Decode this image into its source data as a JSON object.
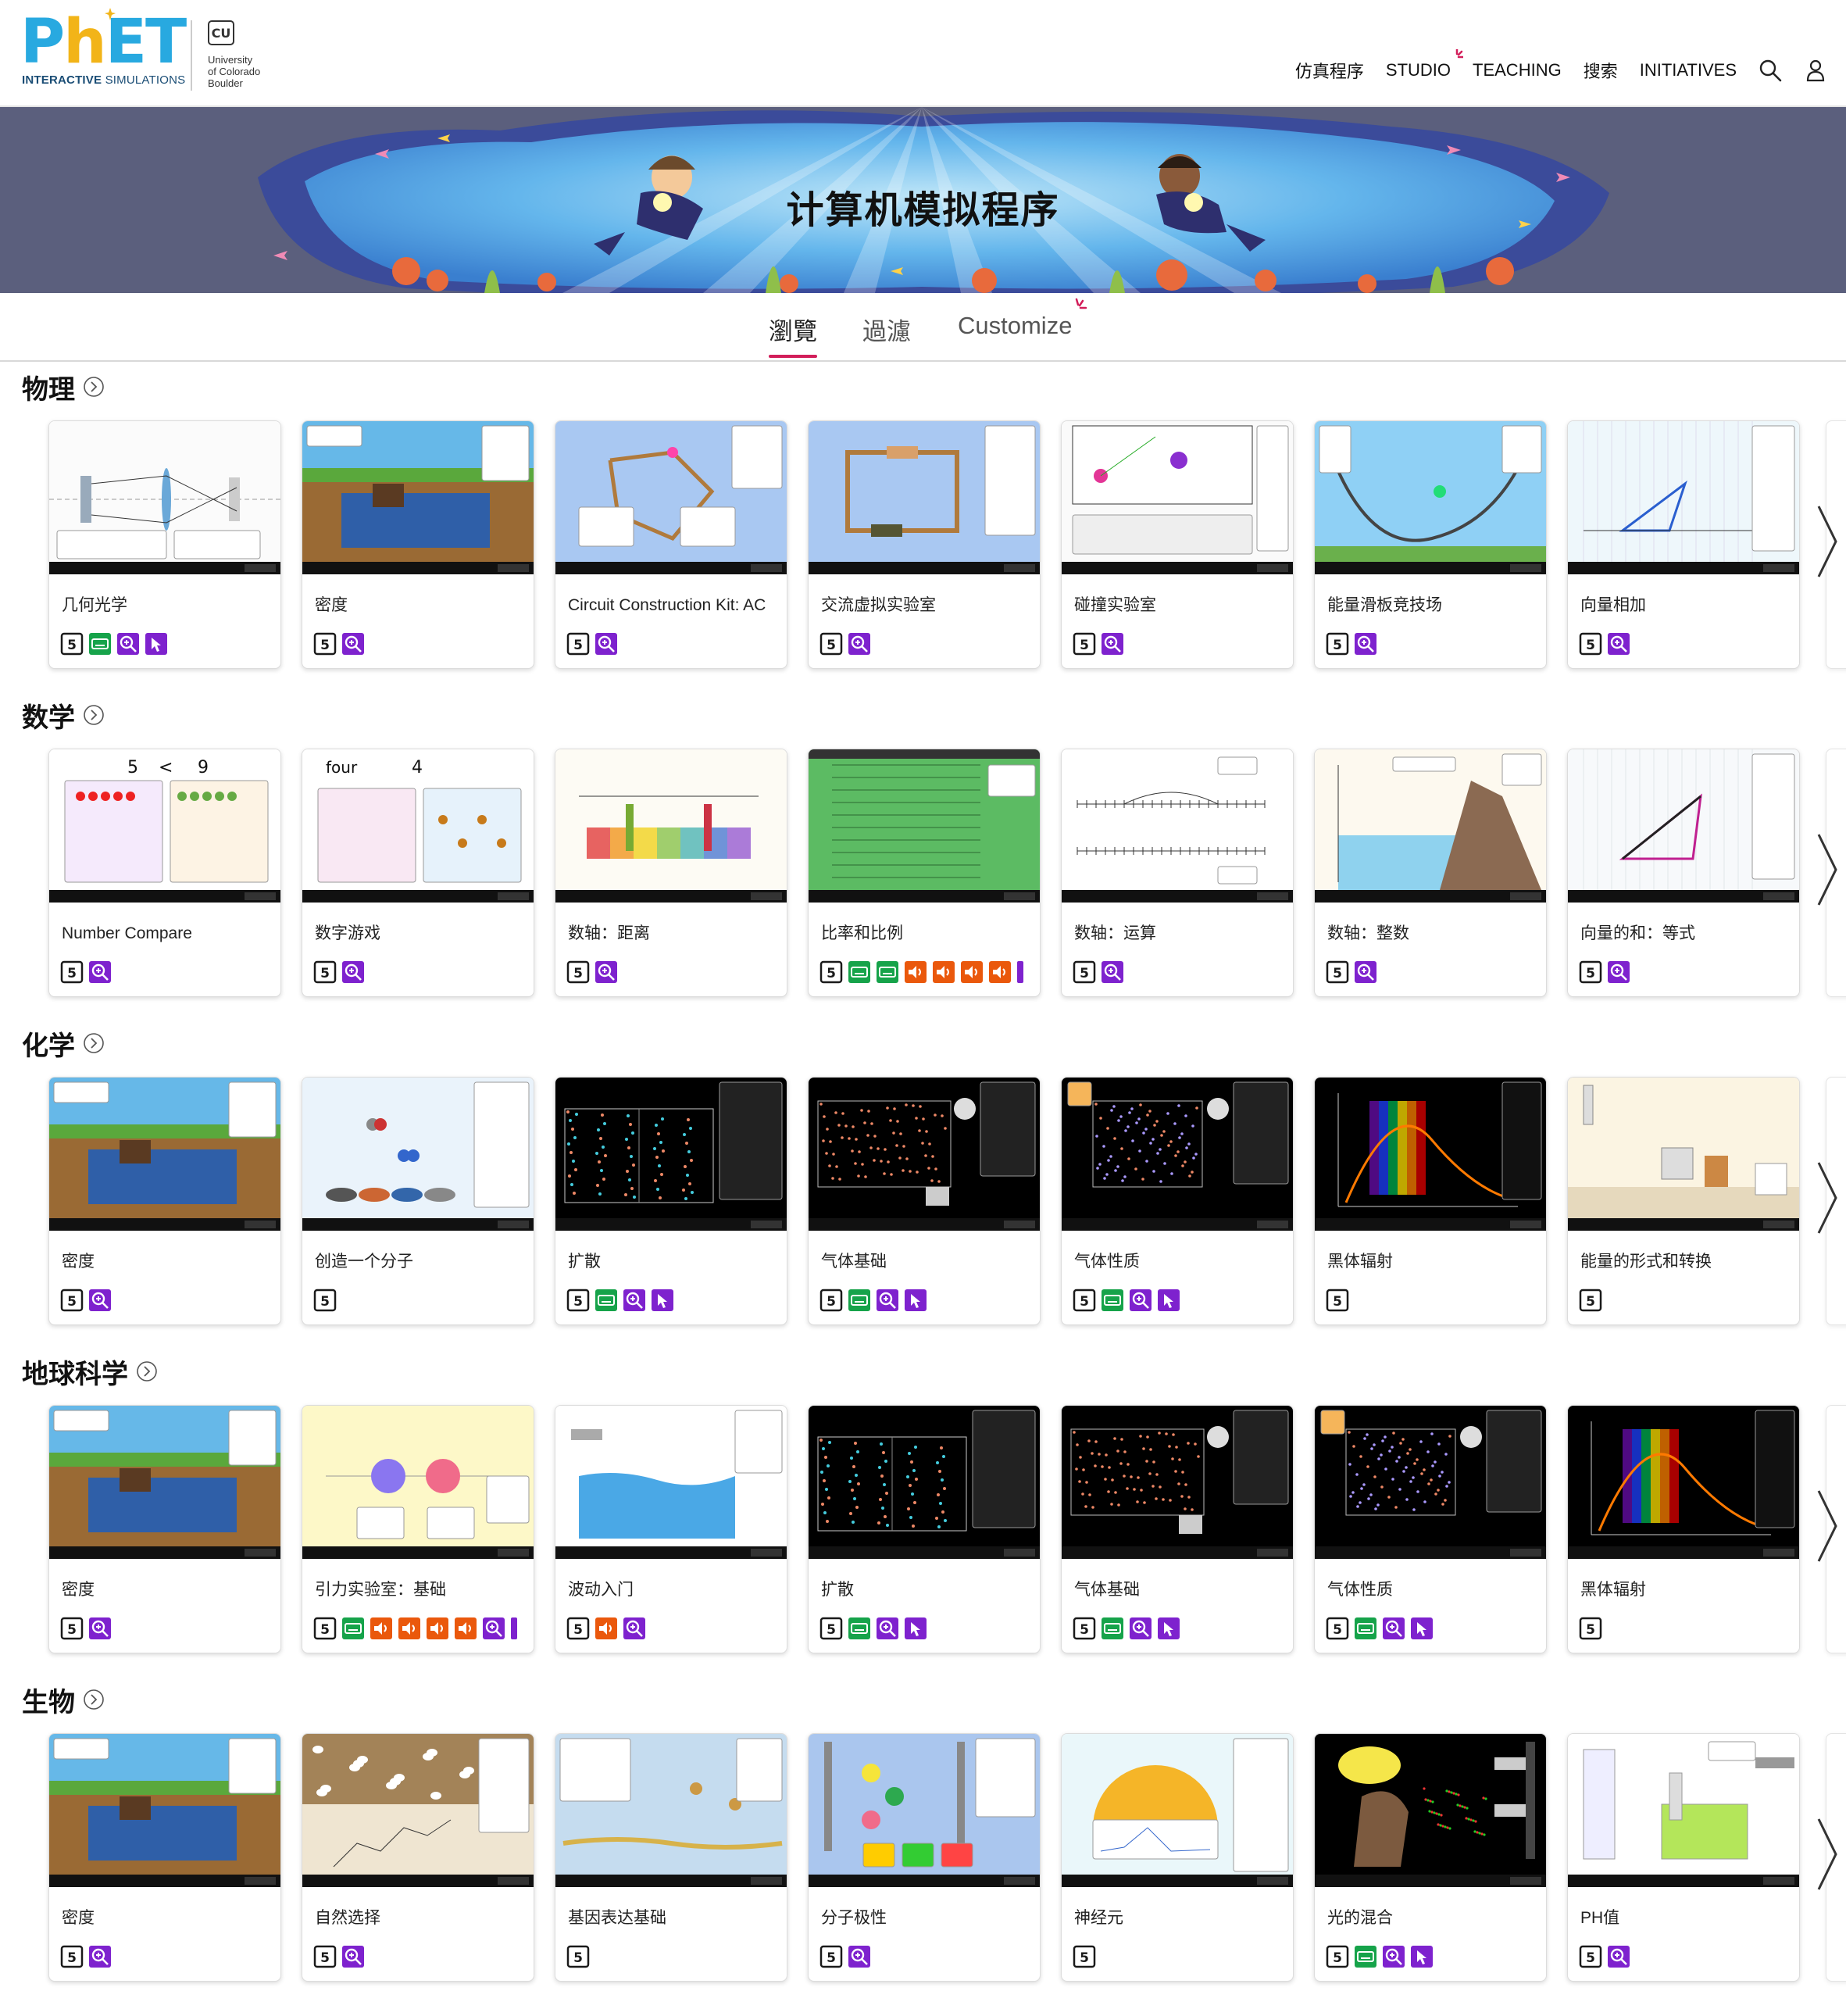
{
  "brand": {
    "logo_text": "PhET",
    "logo_subtitle_bold": "INTERACTIVE",
    "logo_subtitle_rest": " SIMULATIONS",
    "university": [
      "University",
      "of Colorado",
      "Boulder"
    ]
  },
  "nav": {
    "items": [
      "仿真程序",
      "STUDIO",
      "TEACHING",
      "搜索",
      "INITIATIVES"
    ],
    "icons": [
      "search-icon",
      "user-icon"
    ]
  },
  "banner": {
    "title": "计算机模拟程序"
  },
  "tabs": {
    "browse": "瀏覽",
    "filter": "過濾",
    "customize": "Customize"
  },
  "colors": {
    "accent": "#d21e5a",
    "logo_blue": "#28a9e0",
    "logo_yellow": "#f2b418",
    "badge_html5": "#1a1a1a",
    "badge_keyboard": "#16a34a",
    "badge_inclusive": "#7e22ce",
    "badge_sound": "#ea580c"
  },
  "sections": [
    {
      "title": "物理",
      "cards": [
        {
          "title": "几何光学",
          "theme": "optics",
          "badges": [
            "html5",
            "keyboard",
            "zoom",
            "interactive"
          ]
        },
        {
          "title": "密度",
          "theme": "density",
          "badges": [
            "html5",
            "zoom"
          ]
        },
        {
          "title": "Circuit Construction Kit: AC",
          "theme": "circuit",
          "badges": [
            "html5",
            "zoom"
          ]
        },
        {
          "title": "交流虚拟实验室",
          "theme": "circuitlab",
          "badges": [
            "html5",
            "zoom"
          ]
        },
        {
          "title": "碰撞实验室",
          "theme": "collision",
          "badges": [
            "html5",
            "zoom"
          ]
        },
        {
          "title": "能量滑板竞技场",
          "theme": "skate",
          "badges": [
            "html5",
            "zoom"
          ]
        },
        {
          "title": "向量相加",
          "theme": "vector",
          "badges": [
            "html5",
            "zoom"
          ]
        }
      ]
    },
    {
      "title": "数学",
      "cards": [
        {
          "title": "Number Compare",
          "theme": "numcompare",
          "badges": [
            "html5",
            "zoom"
          ]
        },
        {
          "title": "数字游戏",
          "theme": "numplay",
          "badges": [
            "html5",
            "zoom"
          ]
        },
        {
          "title": "数轴：距离",
          "theme": "numline",
          "badges": [
            "html5",
            "zoom"
          ]
        },
        {
          "title": "比率和比例",
          "theme": "ratio",
          "badges": [
            "html5",
            "keyboard",
            "keyboard",
            "sound",
            "sound",
            "sound",
            "sound",
            "more"
          ]
        },
        {
          "title": "数轴：运算",
          "theme": "numops",
          "badges": [
            "html5",
            "zoom"
          ]
        },
        {
          "title": "数轴：整数",
          "theme": "integers",
          "badges": [
            "html5",
            "zoom"
          ]
        },
        {
          "title": "向量的和：等式",
          "theme": "vector2",
          "badges": [
            "html5",
            "zoom"
          ]
        }
      ]
    },
    {
      "title": "化学",
      "cards": [
        {
          "title": "密度",
          "theme": "density",
          "badges": [
            "html5",
            "zoom"
          ]
        },
        {
          "title": "创造一个分子",
          "theme": "molecule",
          "badges": [
            "html5"
          ]
        },
        {
          "title": "扩散",
          "theme": "diffusion",
          "badges": [
            "html5",
            "keyboard",
            "zoom",
            "interactive"
          ]
        },
        {
          "title": "气体基础",
          "theme": "gas",
          "badges": [
            "html5",
            "keyboard",
            "zoom",
            "interactive"
          ]
        },
        {
          "title": "气体性质",
          "theme": "gas2",
          "badges": [
            "html5",
            "keyboard",
            "zoom",
            "interactive"
          ]
        },
        {
          "title": "黑体辐射",
          "theme": "blackbody",
          "badges": [
            "html5"
          ]
        },
        {
          "title": "能量的形式和转换",
          "theme": "energy",
          "badges": [
            "html5"
          ]
        }
      ]
    },
    {
      "title": "地球科学",
      "cards": [
        {
          "title": "密度",
          "theme": "density",
          "badges": [
            "html5",
            "zoom"
          ]
        },
        {
          "title": "引力实验室：基础",
          "theme": "gravity",
          "badges": [
            "html5",
            "keyboard",
            "sound",
            "sound",
            "sound",
            "sound",
            "zoom",
            "more"
          ]
        },
        {
          "title": "波动入门",
          "theme": "waves",
          "badges": [
            "html5",
            "sound",
            "zoom"
          ]
        },
        {
          "title": "扩散",
          "theme": "diffusion",
          "badges": [
            "html5",
            "keyboard",
            "zoom",
            "interactive"
          ]
        },
        {
          "title": "气体基础",
          "theme": "gas",
          "badges": [
            "html5",
            "keyboard",
            "zoom",
            "interactive"
          ]
        },
        {
          "title": "气体性质",
          "theme": "gas2",
          "badges": [
            "html5",
            "keyboard",
            "zoom",
            "interactive"
          ]
        },
        {
          "title": "黑体辐射",
          "theme": "blackbody",
          "badges": [
            "html5"
          ]
        }
      ]
    },
    {
      "title": "生物",
      "cards": [
        {
          "title": "密度",
          "theme": "density",
          "badges": [
            "html5",
            "zoom"
          ]
        },
        {
          "title": "自然选择",
          "theme": "selection",
          "badges": [
            "html5",
            "zoom"
          ]
        },
        {
          "title": "基因表达基础",
          "theme": "gene",
          "badges": [
            "html5"
          ]
        },
        {
          "title": "分子极性",
          "theme": "polarity",
          "badges": [
            "html5",
            "zoom"
          ]
        },
        {
          "title": "神经元",
          "theme": "neuron",
          "badges": [
            "html5"
          ]
        },
        {
          "title": "光的混合",
          "theme": "color",
          "badges": [
            "html5",
            "keyboard",
            "zoom",
            "interactive"
          ]
        },
        {
          "title": "PH值",
          "theme": "ph",
          "badges": [
            "html5",
            "zoom"
          ]
        }
      ]
    }
  ]
}
